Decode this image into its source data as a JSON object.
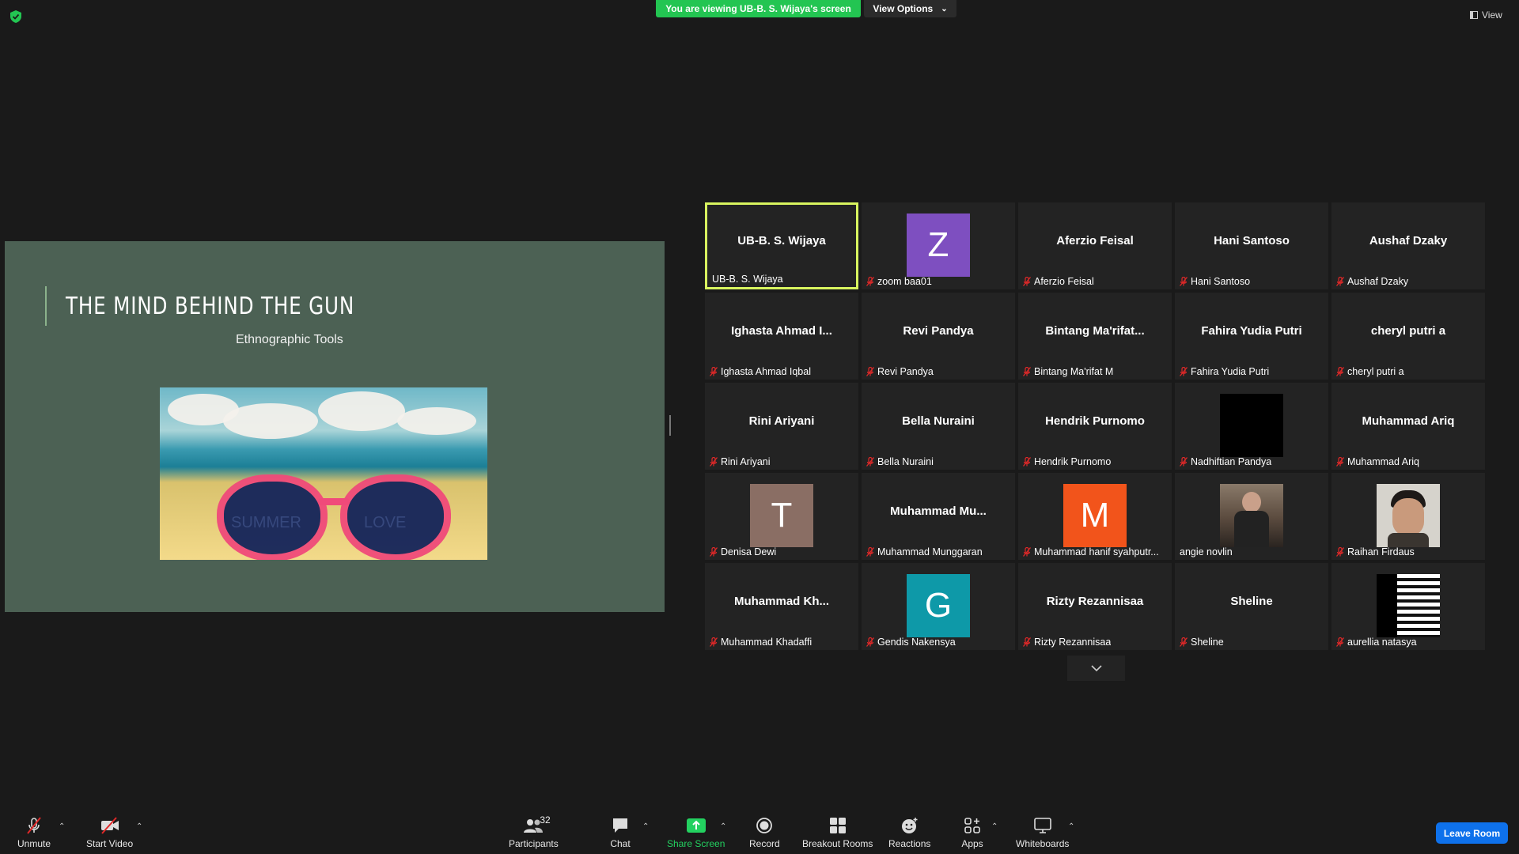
{
  "banner": {
    "viewing_text": "You are viewing UB-B. S. Wijaya's screen",
    "view_options": "View Options",
    "view": "View"
  },
  "slide": {
    "title": "THE MIND BEHIND THE GUN",
    "subtitle": "Ethnographic Tools",
    "img_text_left": "SUMMER",
    "img_text_right": "LOVE"
  },
  "tiles": [
    {
      "center": "UB-B. S. Wijaya",
      "label": "UB-B. S. Wijaya",
      "muted": false,
      "active": true
    },
    {
      "avatar": "Z",
      "avatar_color": "#7e4fc0",
      "label": "zoom baa01",
      "muted": true
    },
    {
      "center": "Aferzio Feisal",
      "label": "Aferzio Feisal",
      "muted": true
    },
    {
      "center": "Hani Santoso",
      "label": "Hani Santoso",
      "muted": true
    },
    {
      "center": "Aushaf Dzaky",
      "label": "Aushaf Dzaky",
      "muted": true
    },
    {
      "center": "Ighasta Ahmad I...",
      "label": "Ighasta Ahmad Iqbal",
      "muted": true
    },
    {
      "center": "Revi Pandya",
      "label": "Revi Pandya",
      "muted": true
    },
    {
      "center": "Bintang  Ma'rifat...",
      "label": "Bintang Ma'rifat M",
      "muted": true
    },
    {
      "center": "Fahira Yudia Putri",
      "label": "Fahira Yudia Putri",
      "muted": true
    },
    {
      "center": "cheryl putri a",
      "label": "cheryl putri a",
      "muted": true
    },
    {
      "center": "Rini Ariyani",
      "label": "Rini Ariyani",
      "muted": true
    },
    {
      "center": "Bella Nuraini",
      "label": "Bella Nuraini",
      "muted": true
    },
    {
      "center": "Hendrik Purnomo",
      "label": "Hendrik Purnomo",
      "muted": true
    },
    {
      "photo": "black",
      "label": "Nadhiftian Pandya",
      "muted": true
    },
    {
      "center": "Muhammad Ariq",
      "label": "Muhammad Ariq",
      "muted": true
    },
    {
      "avatar": "T",
      "avatar_color": "#8a6e64",
      "label": "Denisa Dewi",
      "muted": true
    },
    {
      "center": "Muhammad  Mu...",
      "label": "Muhammad Munggaran",
      "muted": true
    },
    {
      "avatar": "M",
      "avatar_color": "#f2541b",
      "label": "Muhammad hanif syahputr...",
      "muted": true
    },
    {
      "photo": "person-room",
      "label": "angie novlin",
      "muted": false
    },
    {
      "photo": "person-face",
      "label": "Raihan Firdaus",
      "muted": true
    },
    {
      "center": "Muhammad  Kh...",
      "label": "Muhammad Khadaffi",
      "muted": true
    },
    {
      "avatar": "G",
      "avatar_color": "#0e99a8",
      "label": "Gendis Nakensya",
      "muted": true
    },
    {
      "center": "Rizty Rezannisaa",
      "label": "Rizty Rezannisaa",
      "muted": true
    },
    {
      "center": "Sheline",
      "label": "Sheline",
      "muted": true
    },
    {
      "photo": "stripes",
      "label": "aurellia natasya",
      "muted": true
    }
  ],
  "toolbar": {
    "unmute": "Unmute",
    "start_video": "Start Video",
    "participants": "Participants",
    "participants_count": "32",
    "chat": "Chat",
    "share_screen": "Share Screen",
    "record": "Record",
    "breakout": "Breakout Rooms",
    "reactions": "Reactions",
    "apps": "Apps",
    "whiteboards": "Whiteboards",
    "leave": "Leave Room"
  },
  "colors": {
    "banner_green": "#23c552",
    "active_border": "#d8f45f",
    "leave_blue": "#0e71eb",
    "share_green": "#23d160"
  }
}
